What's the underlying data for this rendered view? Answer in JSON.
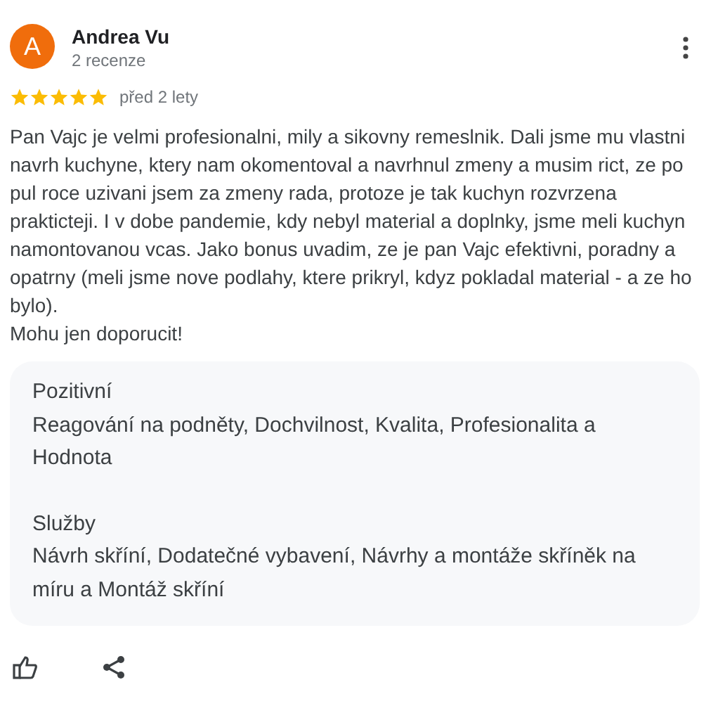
{
  "reviewer": {
    "initial": "A",
    "name": "Andrea Vu",
    "reviews": "2 recenze"
  },
  "rating": {
    "stars": 5,
    "time": "před 2 lety"
  },
  "body": [
    "Pan Vajc je velmi profesionalni, mily a sikovny remeslnik. Dali jsme mu vlastni navrh kuchyne, ktery nam okomentoval a navrhnul zmeny a musim rict, ze po pul roce uzivani jsem za zmeny rada, protoze je tak kuchyn rozvrzena prakticteji. I v dobe pandemie, kdy nebyl material a doplnky, jsme meli kuchyn namontovanou vcas. Jako bonus uvadim, ze je pan Vajc efektivni, poradny a opatrny (meli jsme nove podlahy, ktere prikryl, kdyz pokladal material - a ze ho bylo).",
    "Mohu jen doporucit!"
  ],
  "attributes": [
    {
      "heading": "Pozitivní",
      "value": "Reagování na podněty, Dochvilnost, Kvalita, Profesionalita a Hodnota"
    },
    {
      "heading": "Služby",
      "value": "Návrh skříní, Dodatečné vybavení, Návrhy a montáže skříněk na míru a Montáž skříní"
    }
  ]
}
